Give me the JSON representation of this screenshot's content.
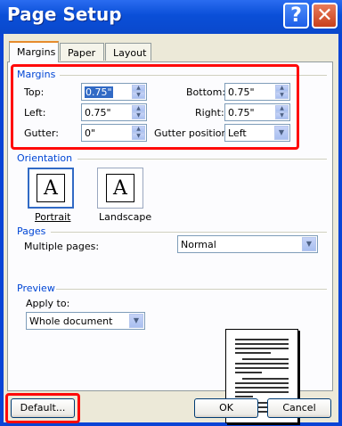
{
  "window": {
    "title": "Page Setup",
    "help_glyph": "?",
    "close_glyph": "✕"
  },
  "tabs": [
    "Margins",
    "Paper",
    "Layout"
  ],
  "margins": {
    "group_label": "Margins",
    "top_label": "Top:",
    "top_value": "0.75\"",
    "bottom_label": "Bottom:",
    "bottom_value": "0.75\"",
    "left_label": "Left:",
    "left_value": "0.75\"",
    "right_label": "Right:",
    "right_value": "0.75\"",
    "gutter_label": "Gutter:",
    "gutter_value": "0\"",
    "gutter_pos_label": "Gutter position:",
    "gutter_pos_value": "Left"
  },
  "orientation": {
    "group_label": "Orientation",
    "portrait": "Portrait",
    "landscape": "Landscape",
    "page_glyph": "A"
  },
  "pages": {
    "group_label": "Pages",
    "multiple_label": "Multiple pages:",
    "multiple_value": "Normal"
  },
  "preview": {
    "group_label": "Preview",
    "apply_label": "Apply to:",
    "apply_value": "Whole document"
  },
  "buttons": {
    "default": "Default...",
    "ok": "OK",
    "cancel": "Cancel"
  },
  "colors": {
    "highlight_red": "#ff0a0a",
    "title_blue": "#0a4fd8",
    "group_text": "#0046d5"
  }
}
